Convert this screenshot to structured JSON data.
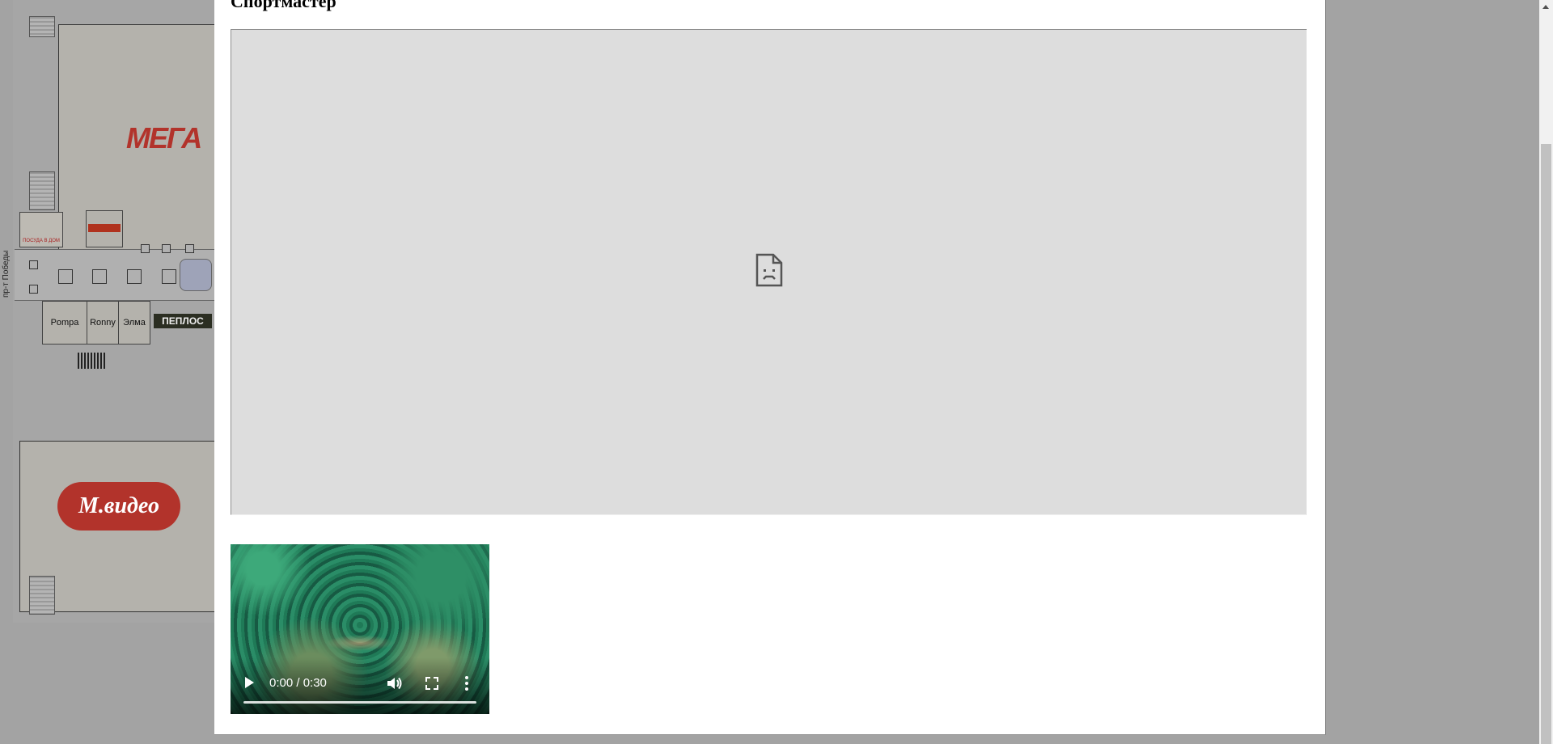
{
  "background_map": {
    "mega_logo": "МЕГА",
    "posuda_logo": "ПОСУДА В ДОМ",
    "shops": [
      "Pompa",
      "Ronny",
      "Элма"
    ],
    "peplos_logo": "ПЕПЛОС",
    "mvideo_logo": "М.видео",
    "street_label": "пр-т Победы"
  },
  "modal": {
    "title": "Спортмастер",
    "embedded_frame": {
      "state": "failed-to-load",
      "icon": "sad-document-icon"
    },
    "video": {
      "current_time": "0:00",
      "duration": "0:30",
      "time_display": "0:00 / 0:30",
      "progress": 0,
      "controls": [
        "play-icon",
        "volume-icon",
        "fullscreen-icon",
        "more-options-icon"
      ]
    }
  },
  "colors": {
    "overlay": "#9c9c9c",
    "modal_bg": "#ffffff",
    "frame_bg": "#dddddd",
    "brand_red": "#b2332b"
  }
}
